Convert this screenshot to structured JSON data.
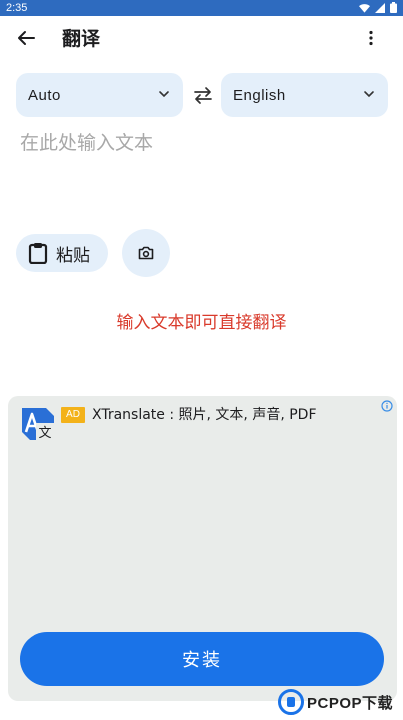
{
  "status_bar": {
    "time": "2:35"
  },
  "app_bar": {
    "title": "翻译"
  },
  "languages": {
    "source": "Auto",
    "target": "English"
  },
  "input": {
    "placeholder": "在此处输入文本"
  },
  "actions": {
    "paste_label": "粘贴"
  },
  "hint": "输入文本即可直接翻译",
  "ad": {
    "badge": "AD",
    "title": "XTranslate : 照片, 文本, 声音, PDF",
    "install_label": "安装"
  },
  "watermark": {
    "text": "PCPOP下载"
  },
  "colors": {
    "status_bar": "#2e6bbf",
    "accent": "#1a73e8",
    "chip_bg": "#e4effa",
    "hint": "#d93a2b",
    "ad_bg": "#e9ecea",
    "ad_badge": "#f3b21a"
  },
  "icons": [
    "back-arrow-icon",
    "more-vert-icon",
    "chevron-down-icon",
    "swap-icon",
    "clipboard-icon",
    "camera-icon",
    "info-icon",
    "wifi-icon",
    "signal-icon",
    "battery-icon"
  ]
}
